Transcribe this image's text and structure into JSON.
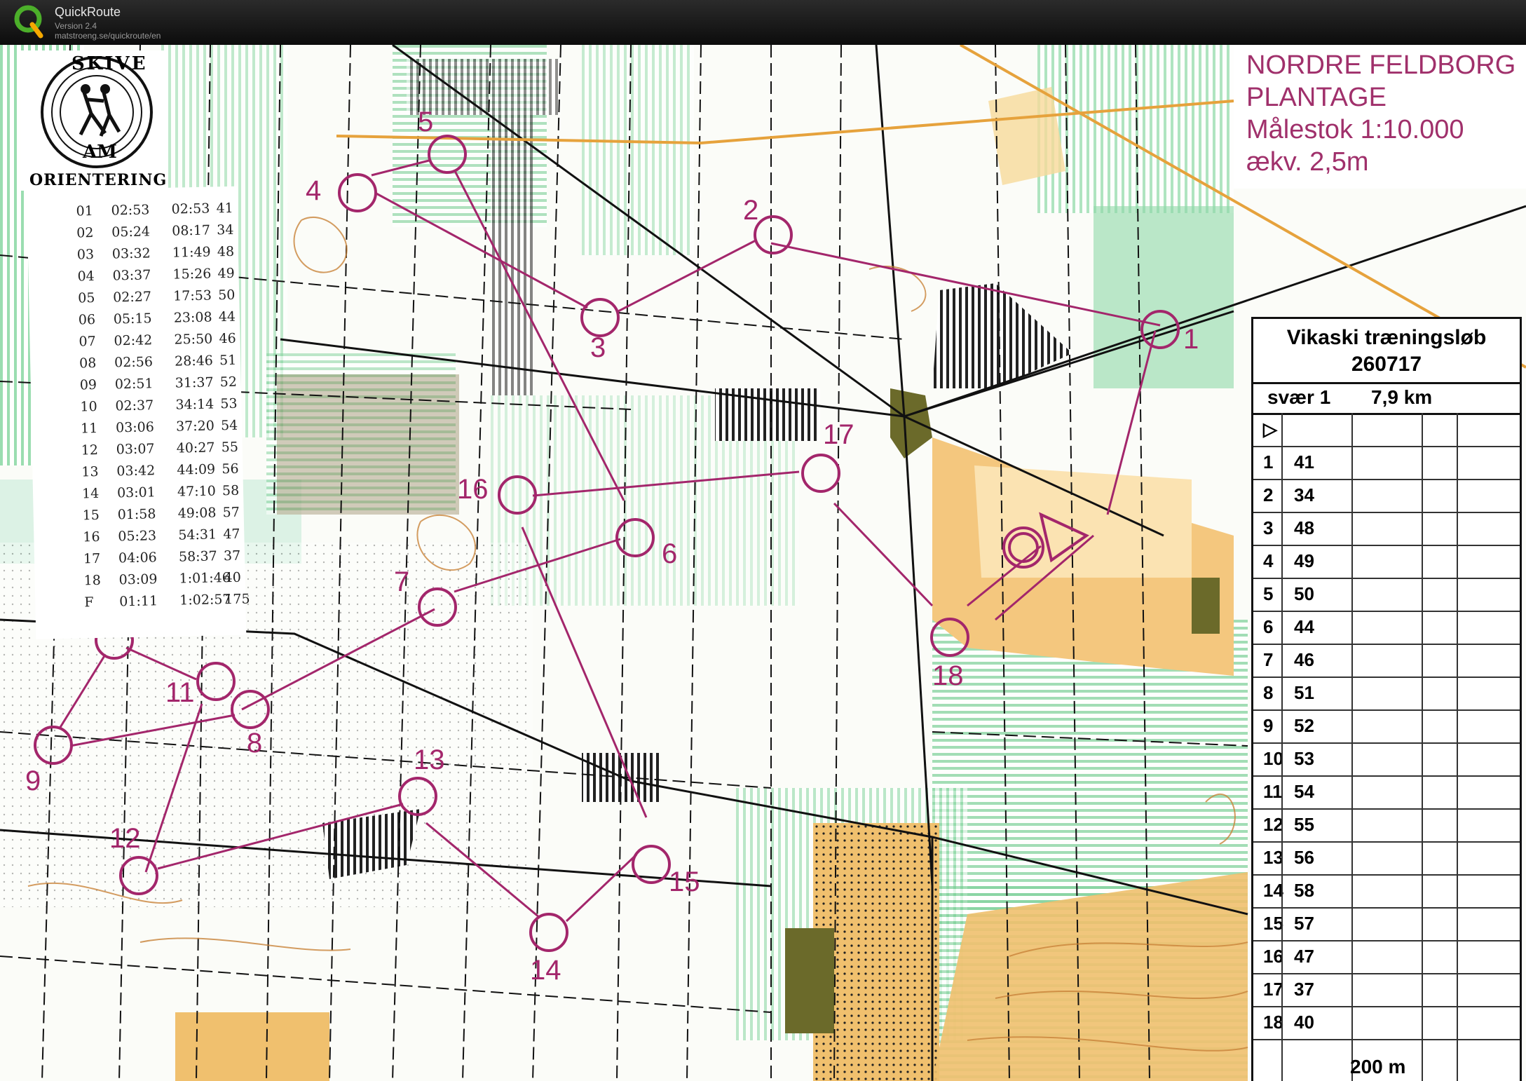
{
  "app": {
    "name": "QuickRoute",
    "version": "Version 2.4",
    "url": "matstroeng.se/quickroute/en"
  },
  "map_title": {
    "line1": "NORDRE FELDBORG",
    "line2": "PLANTAGE",
    "line3": "Målestok 1:10.000",
    "line4": "ækv. 2,5m"
  },
  "logo": {
    "top": "SKIVE",
    "mid": "AM",
    "bottom": "ORIENTERING"
  },
  "splits": [
    {
      "leg": "01",
      "split": "02:53",
      "total": "02:53",
      "code": "41"
    },
    {
      "leg": "02",
      "split": "05:24",
      "total": "08:17",
      "code": "34"
    },
    {
      "leg": "03",
      "split": "03:32",
      "total": "11:49",
      "code": "48"
    },
    {
      "leg": "04",
      "split": "03:37",
      "total": "15:26",
      "code": "49"
    },
    {
      "leg": "05",
      "split": "02:27",
      "total": "17:53",
      "code": "50"
    },
    {
      "leg": "06",
      "split": "05:15",
      "total": "23:08",
      "code": "44"
    },
    {
      "leg": "07",
      "split": "02:42",
      "total": "25:50",
      "code": "46"
    },
    {
      "leg": "08",
      "split": "02:56",
      "total": "28:46",
      "code": "51"
    },
    {
      "leg": "09",
      "split": "02:51",
      "total": "31:37",
      "code": "52"
    },
    {
      "leg": "10",
      "split": "02:37",
      "total": "34:14",
      "code": "53"
    },
    {
      "leg": "11",
      "split": "03:06",
      "total": "37:20",
      "code": "54"
    },
    {
      "leg": "12",
      "split": "03:07",
      "total": "40:27",
      "code": "55"
    },
    {
      "leg": "13",
      "split": "03:42",
      "total": "44:09",
      "code": "56"
    },
    {
      "leg": "14",
      "split": "03:01",
      "total": "47:10",
      "code": "58"
    },
    {
      "leg": "15",
      "split": "01:58",
      "total": "49:08",
      "code": "57"
    },
    {
      "leg": "16",
      "split": "05:23",
      "total": "54:31",
      "code": "47"
    },
    {
      "leg": "17",
      "split": "04:06",
      "total": "58:37",
      "code": "37"
    },
    {
      "leg": "18",
      "split": "03:09",
      "total": "1:01:46",
      "code": "40"
    },
    {
      "leg": "F",
      "split": "01:11",
      "total": "1:02:57",
      "code": "175"
    }
  ],
  "description": {
    "title": "Vikaski træningsløb",
    "date": "260717",
    "class": "svær 1",
    "length": "7,9 km",
    "rows": [
      {
        "num": "1",
        "code": "41"
      },
      {
        "num": "2",
        "code": "34"
      },
      {
        "num": "3",
        "code": "48"
      },
      {
        "num": "4",
        "code": "49"
      },
      {
        "num": "5",
        "code": "50"
      },
      {
        "num": "6",
        "code": "44"
      },
      {
        "num": "7",
        "code": "46"
      },
      {
        "num": "8",
        "code": "51"
      },
      {
        "num": "9",
        "code": "52"
      },
      {
        "num": "10",
        "code": "53"
      },
      {
        "num": "11",
        "code": "54"
      },
      {
        "num": "12",
        "code": "55"
      },
      {
        "num": "13",
        "code": "56"
      },
      {
        "num": "14",
        "code": "58"
      },
      {
        "num": "15",
        "code": "57"
      },
      {
        "num": "16",
        "code": "47"
      },
      {
        "num": "17",
        "code": "37"
      },
      {
        "num": "18",
        "code": "40"
      }
    ],
    "footer_distance": "200 m"
  },
  "controls": [
    {
      "label": "1"
    },
    {
      "label": "2"
    },
    {
      "label": "3"
    },
    {
      "label": "4"
    },
    {
      "label": "5"
    },
    {
      "label": "6"
    },
    {
      "label": "7"
    },
    {
      "label": "8"
    },
    {
      "label": "9"
    },
    {
      "label": "10"
    },
    {
      "label": "11"
    },
    {
      "label": "12"
    },
    {
      "label": "13"
    },
    {
      "label": "14"
    },
    {
      "label": "15"
    },
    {
      "label": "16"
    },
    {
      "label": "17"
    },
    {
      "label": "18"
    }
  ],
  "colors": {
    "course": "#a3266b",
    "vegetation": "#7fd3a0",
    "open_land": "#f2c77a",
    "rough_open": "#fbe7b8"
  }
}
